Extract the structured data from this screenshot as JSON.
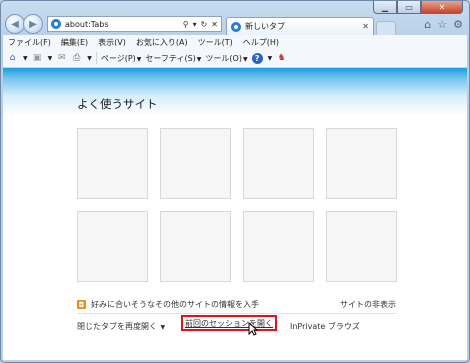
{
  "browser": {
    "address": "about:Tabs",
    "tab_title": "新しいタブ"
  },
  "menu": [
    "ファイル(F)",
    "編集(E)",
    "表示(V)",
    "お気に入り(A)",
    "ツール(T)",
    "ヘルプ(H)"
  ],
  "commands": {
    "page": "ページ(P)",
    "safety": "セーフティ(S)",
    "tools": "ツール(O)"
  },
  "content": {
    "title": "よく使うサイト",
    "info": "好みに合いそうなその他のサイトの情報を入手",
    "hide_sites": "サイトの非表示",
    "reopen_tabs": "閉じたタブを再度開く",
    "reopen_session": "前回のセッションを開く",
    "inprivate": "InPrivate ブラウズ"
  },
  "colors": {
    "highlight_box": "#e3111a",
    "content_top_band": "#1c9ddf"
  }
}
